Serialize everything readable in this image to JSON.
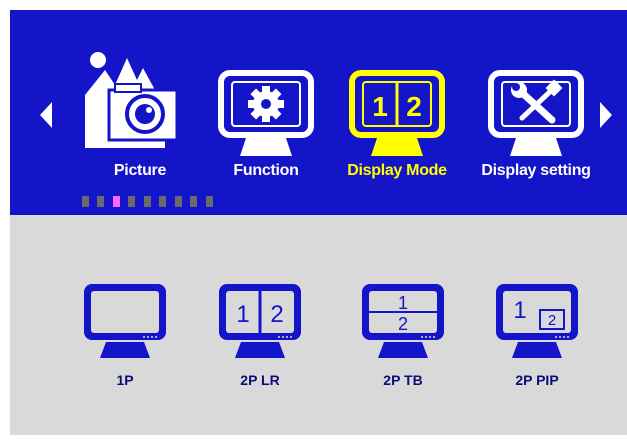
{
  "menu": {
    "items": [
      {
        "label": "Picture",
        "icon": "picture-icon",
        "active": false
      },
      {
        "label": "Function",
        "icon": "gear-monitor-icon",
        "active": false
      },
      {
        "label": "Display Mode",
        "icon": "split-screen-icon",
        "active": true
      },
      {
        "label": "Display setting",
        "icon": "tools-monitor-icon",
        "active": false
      }
    ],
    "page_indicator": {
      "total": 9,
      "current": 3
    }
  },
  "display_mode": {
    "options": [
      {
        "label": "1P",
        "icon": "single-screen-icon"
      },
      {
        "label": "2P  LR",
        "icon": "split-left-right-icon",
        "text_left": "1",
        "text_right": "2"
      },
      {
        "label": "2P TB",
        "icon": "split-top-bottom-icon",
        "text_top": "1",
        "text_bottom": "2"
      },
      {
        "label": "2P PIP",
        "icon": "picture-in-picture-icon",
        "text_main": "1",
        "text_pip": "2"
      }
    ]
  },
  "colors": {
    "topbar": "#1414c8",
    "bottom": "#d9d9d9",
    "active_menu": "#ffff00",
    "mode_icon": "#1414c8",
    "mode_label": "#0c0c78",
    "indicator": "#6a6a6a",
    "indicator_active": "#ff66ff"
  }
}
